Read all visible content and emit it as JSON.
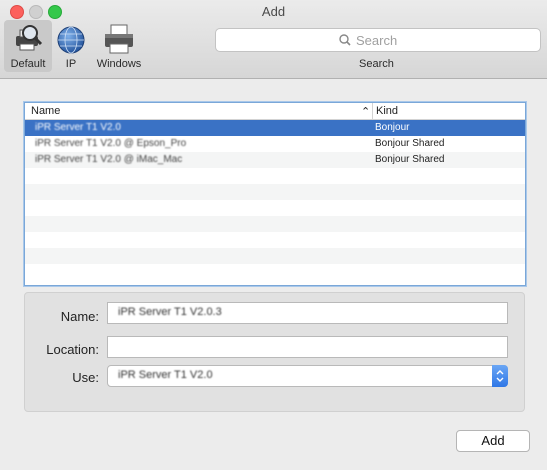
{
  "window": {
    "title": "Add"
  },
  "toolbar": {
    "items": [
      {
        "label": "Default",
        "icon": "printer-magnifier-icon",
        "selected": true
      },
      {
        "label": "IP",
        "icon": "globe-icon",
        "selected": false
      },
      {
        "label": "Windows",
        "icon": "printer-icon",
        "selected": false
      }
    ],
    "search": {
      "placeholder": "Search",
      "label": "Search"
    }
  },
  "printer_list": {
    "columns": {
      "name": "Name",
      "kind": "Kind"
    },
    "rows": [
      {
        "name": "iPR Server T1 V2.0",
        "kind": "Bonjour",
        "selected": true
      },
      {
        "name": "iPR Server T1 V2.0 @ Epson_Pro",
        "kind": "Bonjour Shared",
        "selected": false
      },
      {
        "name": "iPR Server T1 V2.0 @ iMac_Mac",
        "kind": "Bonjour Shared",
        "selected": false
      }
    ]
  },
  "form": {
    "name_label": "Name:",
    "name_value": "iPR Server T1 V2.0.3",
    "location_label": "Location:",
    "location_value": "",
    "use_label": "Use:",
    "use_value": "iPR Server T1 V2.0"
  },
  "actions": {
    "add_label": "Add"
  }
}
